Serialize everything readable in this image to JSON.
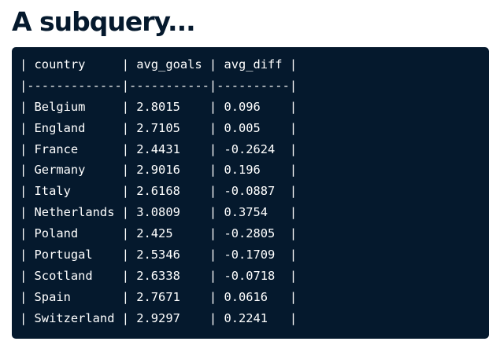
{
  "slide": {
    "title": "A subquery..."
  },
  "code": {
    "lines": [
      "| country     | avg_goals | avg_diff |",
      "|-------------|-----------|----------|",
      "| Belgium     | 2.8015    | 0.096    |",
      "| England     | 2.7105    | 0.005    |",
      "| France      | 2.4431    | -0.2624  |",
      "| Germany     | 2.9016    | 0.196    |",
      "| Italy       | 2.6168    | -0.0887  |",
      "| Netherlands | 3.0809    | 0.3754   |",
      "| Poland      | 2.425     | -0.2805  |",
      "| Portugal    | 2.5346    | -0.1709  |",
      "| Scotland    | 2.6338    | -0.0718  |",
      "| Spain       | 2.7671    | 0.0616   |",
      "| Switzerland | 2.9297    | 0.2241   |"
    ]
  },
  "colors": {
    "title": "#05192d",
    "panel_background": "#05192d",
    "code_text": "#ffffff",
    "page_background": "#ffffff"
  }
}
